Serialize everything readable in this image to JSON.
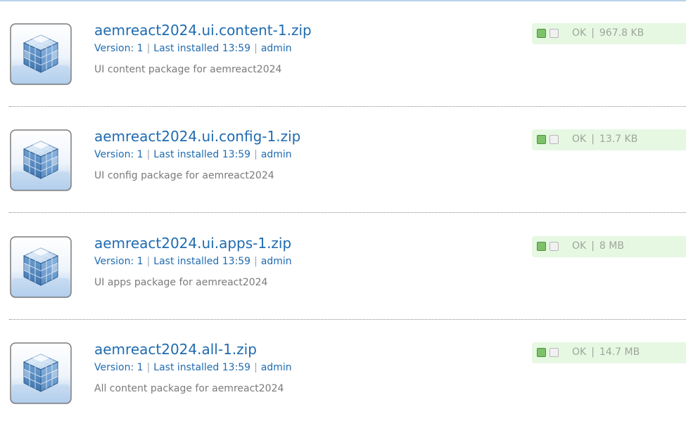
{
  "packages": [
    {
      "name": "aemreact2024.ui.content-1.zip",
      "version_label": "Version: 1",
      "installed_label": "Last installed 13:59",
      "user": "admin",
      "description": "UI content package for aemreact2024",
      "status": "OK",
      "size": "967.8 KB",
      "icon": "package-cube-icon"
    },
    {
      "name": "aemreact2024.ui.config-1.zip",
      "version_label": "Version: 1",
      "installed_label": "Last installed 13:59",
      "user": "admin",
      "description": "UI config package for aemreact2024",
      "status": "OK",
      "size": "13.7 KB",
      "icon": "package-cube-icon"
    },
    {
      "name": "aemreact2024.ui.apps-1.zip",
      "version_label": "Version: 1",
      "installed_label": "Last installed 13:59",
      "user": "admin",
      "description": "UI apps package for aemreact2024",
      "status": "OK",
      "size": "8 MB",
      "icon": "package-cube-icon"
    },
    {
      "name": "aemreact2024.all-1.zip",
      "version_label": "Version: 1",
      "installed_label": "Last installed 13:59",
      "user": "admin",
      "description": "All content package for aemreact2024",
      "status": "OK",
      "size": "14.7 MB",
      "icon": "package-cube-icon"
    }
  ],
  "separator": "|",
  "colors": {
    "link": "#1f6bb0",
    "description": "#7a7a7a",
    "status_bg": "#e6f8e2",
    "status_text": "#9ea59c",
    "status_ok": "#7dc26a"
  }
}
